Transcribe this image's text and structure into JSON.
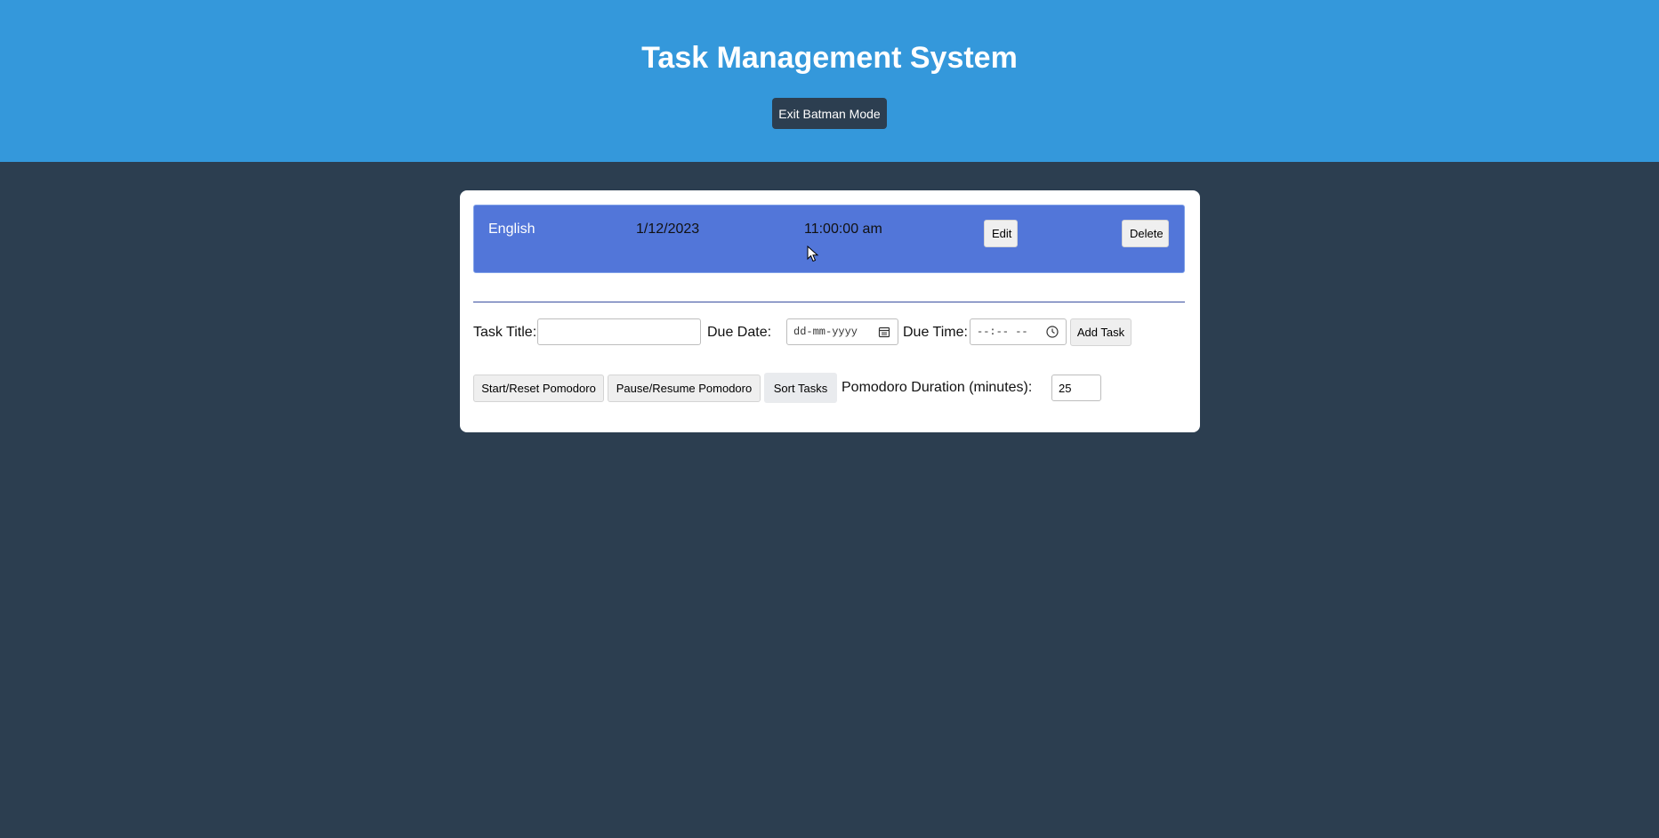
{
  "header": {
    "title": "Task Management System",
    "mode_button": "Exit Batman Mode"
  },
  "tasks": [
    {
      "title": "English",
      "due_date": "1/12/2023",
      "due_time": "11:00:00 am",
      "edit_label": "Edit",
      "delete_label": "Delete"
    }
  ],
  "form": {
    "title_label": "Task Title:",
    "title_value": "",
    "date_label": "Due Date:",
    "date_placeholder": "dd-mm-yyyy",
    "time_label": "Due Time:",
    "time_placeholder": "--:-- --",
    "add_label": "Add Task"
  },
  "actions": {
    "start_reset": "Start/Reset Pomodoro",
    "pause_resume": "Pause/Resume Pomodoro",
    "sort": "Sort Tasks",
    "duration_label": "Pomodoro Duration (minutes):",
    "duration_value": "25"
  },
  "icons": {
    "date": "calendar-icon",
    "time": "clock-icon"
  },
  "colors": {
    "header_bg": "#3498db",
    "page_bg": "#2c3e50",
    "task_bg": "#5276d9",
    "card_bg": "#ffffff"
  }
}
